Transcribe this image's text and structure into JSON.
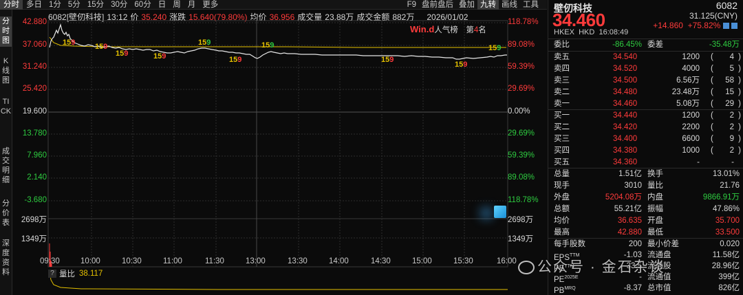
{
  "topbar": {
    "tabs": [
      "分时",
      "多日",
      "1分",
      "5分",
      "15分",
      "30分",
      "60分",
      "日",
      "周",
      "月",
      "更多"
    ],
    "right_tabs": [
      "F9",
      "盘前盘后",
      "叠加",
      "九转",
      "画线",
      "工具"
    ]
  },
  "vtabs": [
    "分时图",
    "K线图",
    "TICK",
    "成交明细",
    "分价表",
    "深度资料"
  ],
  "info": {
    "code": "6082[壁仞科技]",
    "time": "13:12",
    "price_label": "价",
    "price": "35.240",
    "change_label": "涨跌",
    "change": "15.640(79.80%)",
    "avg_label": "均价",
    "avg": "36.956",
    "vol_label": "成交量",
    "vol": "23.88万",
    "amt_label": "成交金额",
    "amt": "882万",
    "date": "2026/01/02"
  },
  "popularity": {
    "logo": "Win.d",
    "label": "人气榜",
    "rank_prefix": "第",
    "rank": "4",
    "rank_suffix": "名"
  },
  "price_axis": {
    "left": [
      "42.880",
      "37.060",
      "31.240",
      "25.420",
      "19.600",
      "13.780",
      "7.960",
      "2.140",
      "-3.680"
    ],
    "right": [
      "118.78%",
      "89.08%",
      "59.39%",
      "29.69%",
      "0.00%",
      "29.69%",
      "59.39%",
      "89.08%",
      "118.78%"
    ],
    "volume_left": [
      "2698万",
      "1349万"
    ],
    "volume_right": [
      "2698万",
      "1349万"
    ]
  },
  "time_axis": [
    "09:30",
    "10:00",
    "10:30",
    "11:00",
    "11:30",
    "13:00",
    "13:30",
    "14:00",
    "14:30",
    "15:00",
    "15:30",
    "16:00"
  ],
  "nine_turn": [
    {
      "a": "1",
      "b": "5",
      "c": "9"
    },
    {
      "a": "1",
      "b": "5",
      "c": "9"
    },
    {
      "a": "1",
      "b": "5",
      "c": "9"
    },
    {
      "a": "1",
      "b": "5",
      "c": "9"
    },
    {
      "a": "1",
      "b": "5",
      "c": "9"
    },
    {
      "a": "1",
      "b": "5",
      "c": "9"
    },
    {
      "a": "1",
      "b": "5",
      "c": "9"
    },
    {
      "a": "1",
      "b": "5",
      "c": "9"
    },
    {
      "a": "1",
      "b": "5",
      "c": "9"
    },
    {
      "a": "1",
      "b": "5",
      "c": "9"
    }
  ],
  "ratio": {
    "label": "量比",
    "value": "38.117"
  },
  "quote": {
    "name": "壁仞科技",
    "code": "6082",
    "price": "34.460",
    "cny": "31.125(CNY)",
    "change": "+14.860",
    "change_pct": "+75.82%",
    "exchange": "HKEX",
    "currency": "HKD",
    "time": "16:08:49"
  },
  "committee": {
    "ratio_label": "委比",
    "ratio": "-86.45%",
    "diff_label": "委差",
    "diff": "-35.48万"
  },
  "asks": [
    {
      "label": "卖五",
      "price": "34.540",
      "vol": "1200",
      "count": "4"
    },
    {
      "label": "卖四",
      "price": "34.520",
      "vol": "4000",
      "count": "5"
    },
    {
      "label": "卖三",
      "price": "34.500",
      "vol": "6.56万",
      "count": "58"
    },
    {
      "label": "卖二",
      "price": "34.480",
      "vol": "23.48万",
      "count": "15"
    },
    {
      "label": "卖一",
      "price": "34.460",
      "vol": "5.08万",
      "count": "29"
    }
  ],
  "bids": [
    {
      "label": "买一",
      "price": "34.440",
      "vol": "1200",
      "count": "2"
    },
    {
      "label": "买二",
      "price": "34.420",
      "vol": "2200",
      "count": "2"
    },
    {
      "label": "买三",
      "price": "34.400",
      "vol": "6600",
      "count": "9"
    },
    {
      "label": "买四",
      "price": "34.380",
      "vol": "1000",
      "count": "2"
    },
    {
      "label": "买五",
      "price": "34.360",
      "vol": "-",
      "count": "-"
    }
  ],
  "stats": [
    {
      "l1": "总量",
      "v1": "1.51亿",
      "c1": "w",
      "l2": "换手",
      "v2": "13.01%",
      "c2": "w"
    },
    {
      "l1": "现手",
      "v1": "3010",
      "c1": "w",
      "l2": "量比",
      "v2": "21.76",
      "c2": "w"
    },
    {
      "l1": "外盘",
      "v1": "5204.08万",
      "c1": "r",
      "l2": "内盘",
      "v2": "9866.91万",
      "c2": "g"
    },
    {
      "l1": "总额",
      "v1": "55.21亿",
      "c1": "w",
      "l2": "振幅",
      "v2": "47.86%",
      "c2": "w"
    },
    {
      "l1": "均价",
      "v1": "36.635",
      "c1": "r",
      "l2": "开盘",
      "v2": "35.700",
      "c2": "r"
    },
    {
      "l1": "最高",
      "v1": "42.880",
      "c1": "r",
      "l2": "最低",
      "v2": "33.500",
      "c2": "r"
    },
    {
      "l1": "每手股数",
      "v1": "200",
      "c1": "w",
      "l2": "最小价差",
      "v2": "0.020",
      "c2": "w"
    },
    {
      "l1": "EPS",
      "v1": "-1.03",
      "c1": "w",
      "l2": "流通盘",
      "v2": "11.58亿",
      "c2": "w",
      "sup1": "TTM"
    },
    {
      "l1": "PE",
      "v1": "-33.5",
      "c1": "w",
      "l2": "流通股",
      "v2": "28.96亿",
      "c2": "w",
      "sup1": "TTM"
    },
    {
      "l1": "PE",
      "v1": "-",
      "c1": "w",
      "l2": "流通值",
      "v2": "399亿",
      "c2": "w",
      "sup1": "2025E"
    },
    {
      "l1": "PB",
      "v1": "-8.37",
      "c1": "w",
      "l2": "总市值",
      "v2": "826亿",
      "c2": "w",
      "sup1": "MRQ"
    }
  ],
  "watermark": "公众号 · 金石杂谈",
  "colors": {
    "up": "#ff3b3b",
    "down": "#2ecc40",
    "avg_line": "#e5c100",
    "price_line": "#e6e6e6"
  }
}
